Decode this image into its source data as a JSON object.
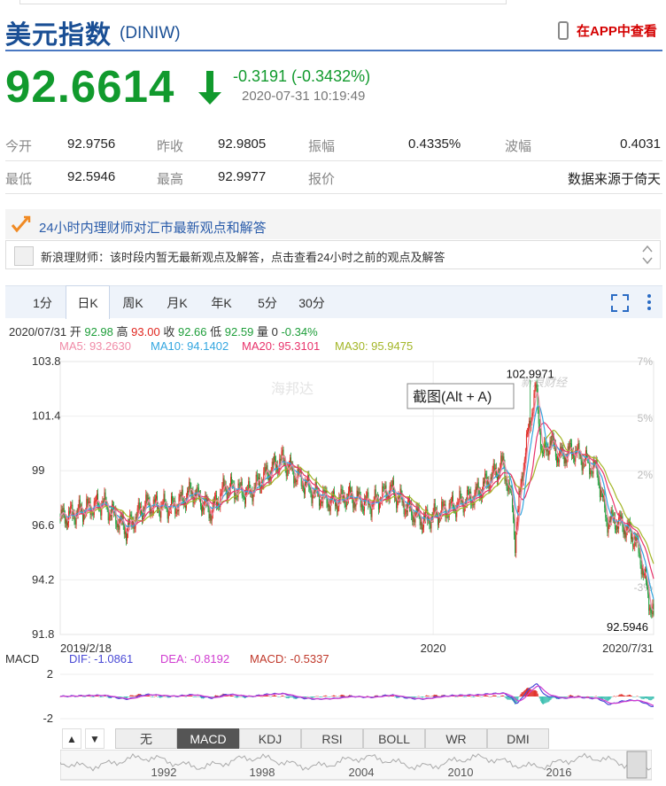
{
  "header": {
    "title": "美元指数",
    "code": "(DINIW)",
    "app_link": "在APP中查看"
  },
  "quote": {
    "price": "92.6614",
    "change": "-0.3191 (-0.3432%)",
    "time": "2020-07-31 10:19:49"
  },
  "stats": {
    "open_label": "今开",
    "open": "92.9756",
    "prev_close_label": "昨收",
    "prev_close": "92.9805",
    "amplitude_label": "振幅",
    "amplitude": "0.4335%",
    "wave_label": "波幅",
    "wave": "0.4031",
    "low_label": "最低",
    "low": "92.5946",
    "high_label": "最高",
    "high": "92.9977",
    "quote_label": "报价",
    "source": "数据来源于倚天"
  },
  "advisor": {
    "heading": "24小时内理财师对汇市最新观点和解答",
    "message": "新浪理财师：该时段内暂无最新观点及解答，点击查看24小时之前的观点及解答"
  },
  "tabs": [
    "1分",
    "日K",
    "周K",
    "月K",
    "年K",
    "5分",
    "30分"
  ],
  "active_tab": "日K",
  "kline_info": {
    "date": "2020/07/31",
    "open_l": "开",
    "open": "92.98",
    "high_l": "高",
    "high": "93.00",
    "close_l": "收",
    "close": "92.66",
    "low_l": "低",
    "low": "92.59",
    "vol_l": "量",
    "vol": "0",
    "chg": "-0.34%"
  },
  "ma": {
    "ma5": "MA5: 93.2630",
    "ma10": "MA10: 94.1402",
    "ma20": "MA20: 95.3101",
    "ma30": "MA30: 95.9475"
  },
  "colors": {
    "ma5": "#f08aa6",
    "ma10": "#33a6e0",
    "ma20": "#e8336b",
    "ma30": "#a3b627",
    "up": "#e0261f",
    "down": "#1e9e3a",
    "brand": "#1a4f95"
  },
  "chart_data": {
    "type": "candlestick",
    "y_ticks_left": [
      "103.8",
      "101.4",
      "99",
      "96.6",
      "94.2",
      "91.8"
    ],
    "y_ticks_right": [
      "7%",
      "5%",
      "2%",
      "-3%"
    ],
    "x_labels": [
      "2019/2/18",
      "2020",
      "2020/7/31"
    ],
    "max_label": "102.9971",
    "min_label": "92.5946",
    "close_keypoints": [
      [
        0,
        96.9
      ],
      [
        20,
        97.2
      ],
      [
        45,
        97.6
      ],
      [
        70,
        96.4
      ],
      [
        90,
        97.5
      ],
      [
        120,
        97.4
      ],
      [
        140,
        98.1
      ],
      [
        160,
        97.2
      ],
      [
        175,
        98.3
      ],
      [
        200,
        98.0
      ],
      [
        220,
        98.9
      ],
      [
        235,
        99.5
      ],
      [
        250,
        98.8
      ],
      [
        270,
        98.0
      ],
      [
        290,
        97.6
      ],
      [
        305,
        97.9
      ],
      [
        330,
        97.5
      ],
      [
        350,
        98.2
      ],
      [
        370,
        97.3
      ],
      [
        385,
        96.8
      ],
      [
        395,
        97.0
      ],
      [
        420,
        97.5
      ],
      [
        440,
        97.9
      ],
      [
        455,
        98.6
      ],
      [
        470,
        99.3
      ],
      [
        480,
        97.5
      ],
      [
        483,
        95.9
      ],
      [
        490,
        98.8
      ],
      [
        500,
        101.5
      ],
      [
        505,
        102.6
      ],
      [
        512,
        99.6
      ],
      [
        520,
        100.3
      ],
      [
        530,
        99.6
      ],
      [
        545,
        99.9
      ],
      [
        555,
        99.5
      ],
      [
        570,
        99.0
      ],
      [
        580,
        96.8
      ],
      [
        590,
        96.8
      ],
      [
        600,
        96.5
      ],
      [
        610,
        96.0
      ],
      [
        618,
        94.8
      ],
      [
        625,
        93.3
      ],
      [
        630,
        92.66
      ]
    ],
    "tooltip": "截图(Alt + A)",
    "watermarks": [
      "新浪财经",
      "海邦达"
    ]
  },
  "macd": {
    "name": "MACD",
    "dif": "DIF: -1.0861",
    "dea": "DEA: -0.8192",
    "macd": "MACD: -0.5337",
    "ticks": [
      "2",
      "-2"
    ]
  },
  "bottom_tabs": [
    "无",
    "MACD",
    "KDJ",
    "RSI",
    "BOLL",
    "WR",
    "DMI"
  ],
  "active_bottom": "MACD",
  "nav_labels": [
    "▲",
    "▼"
  ],
  "timeline_years": [
    "1992",
    "1998",
    "2004",
    "2010",
    "2016"
  ]
}
